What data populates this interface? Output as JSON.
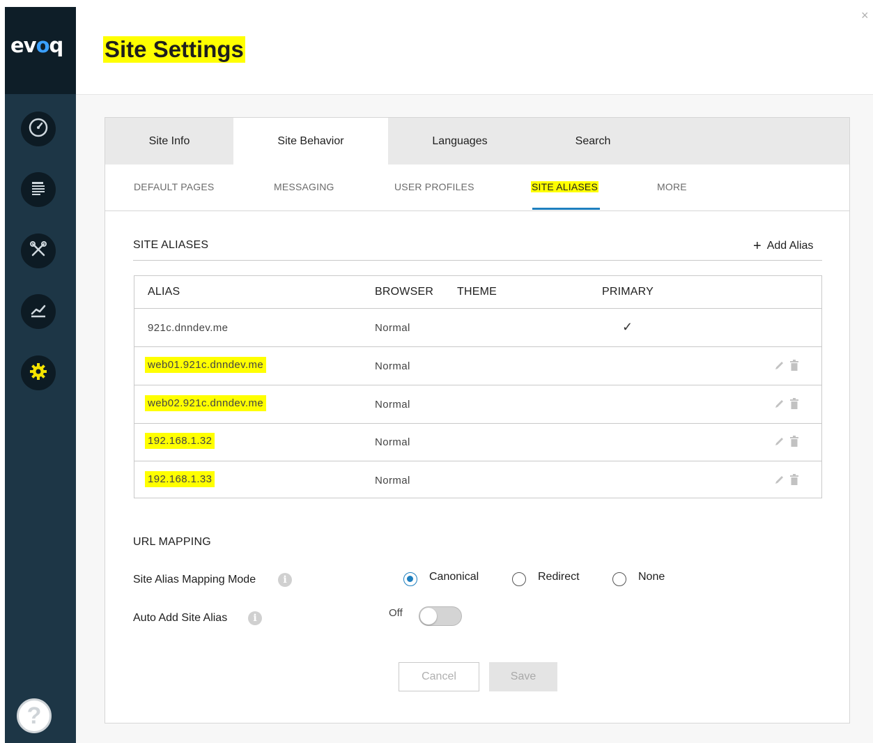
{
  "app": {
    "logo_text": "evoq",
    "title": "Site Settings"
  },
  "sidebar": {
    "items": [
      {
        "name": "dashboard",
        "icon": "gauge-icon"
      },
      {
        "name": "content",
        "icon": "content-list-icon"
      },
      {
        "name": "manage",
        "icon": "tools-icon"
      },
      {
        "name": "insights",
        "icon": "chart-icon"
      },
      {
        "name": "settings",
        "icon": "gear-icon",
        "active": true
      }
    ],
    "help_label": "?"
  },
  "close_label": "×",
  "tabs": [
    {
      "label": "Site Info"
    },
    {
      "label": "Site Behavior",
      "active": true
    },
    {
      "label": "Languages"
    },
    {
      "label": "Search"
    }
  ],
  "subtabs": [
    {
      "label": "DEFAULT PAGES"
    },
    {
      "label": "MESSAGING"
    },
    {
      "label": "USER PROFILES"
    },
    {
      "label": "SITE ALIASES",
      "active": true
    },
    {
      "label": "MORE"
    }
  ],
  "site_aliases": {
    "title": "SITE ALIASES",
    "add_label": "Add Alias",
    "add_icon": "+",
    "columns": [
      "ALIAS",
      "BROWSER",
      "THEME",
      "PRIMARY"
    ],
    "rows": [
      {
        "alias": "921c.dnndev.me",
        "browser": "Normal",
        "theme": "",
        "primary": true,
        "highlighted": false
      },
      {
        "alias": "web01.921c.dnndev.me",
        "browser": "Normal",
        "theme": "",
        "primary": false,
        "highlighted": true
      },
      {
        "alias": "web02.921c.dnndev.me",
        "browser": "Normal",
        "theme": "",
        "primary": false,
        "highlighted": true
      },
      {
        "alias": "192.168.1.32",
        "browser": "Normal",
        "theme": "",
        "primary": false,
        "highlighted": true
      },
      {
        "alias": "192.168.1.33",
        "browser": "Normal",
        "theme": "",
        "primary": false,
        "highlighted": true
      }
    ],
    "primary_check": "✓"
  },
  "url_mapping": {
    "title": "URL MAPPING",
    "mode_label": "Site Alias Mapping Mode",
    "mode_options": [
      "Canonical",
      "Redirect",
      "None"
    ],
    "mode_selected": "Canonical",
    "auto_add_label": "Auto Add Site Alias",
    "auto_add_state": "Off",
    "info_glyph": "i"
  },
  "actions": {
    "cancel_label": "Cancel",
    "save_label": "Save"
  },
  "colors": {
    "highlight": "#ffff00",
    "accent": "#1e7fbf",
    "sidebar": "#1d3646",
    "active_icon": "#f5e400"
  }
}
